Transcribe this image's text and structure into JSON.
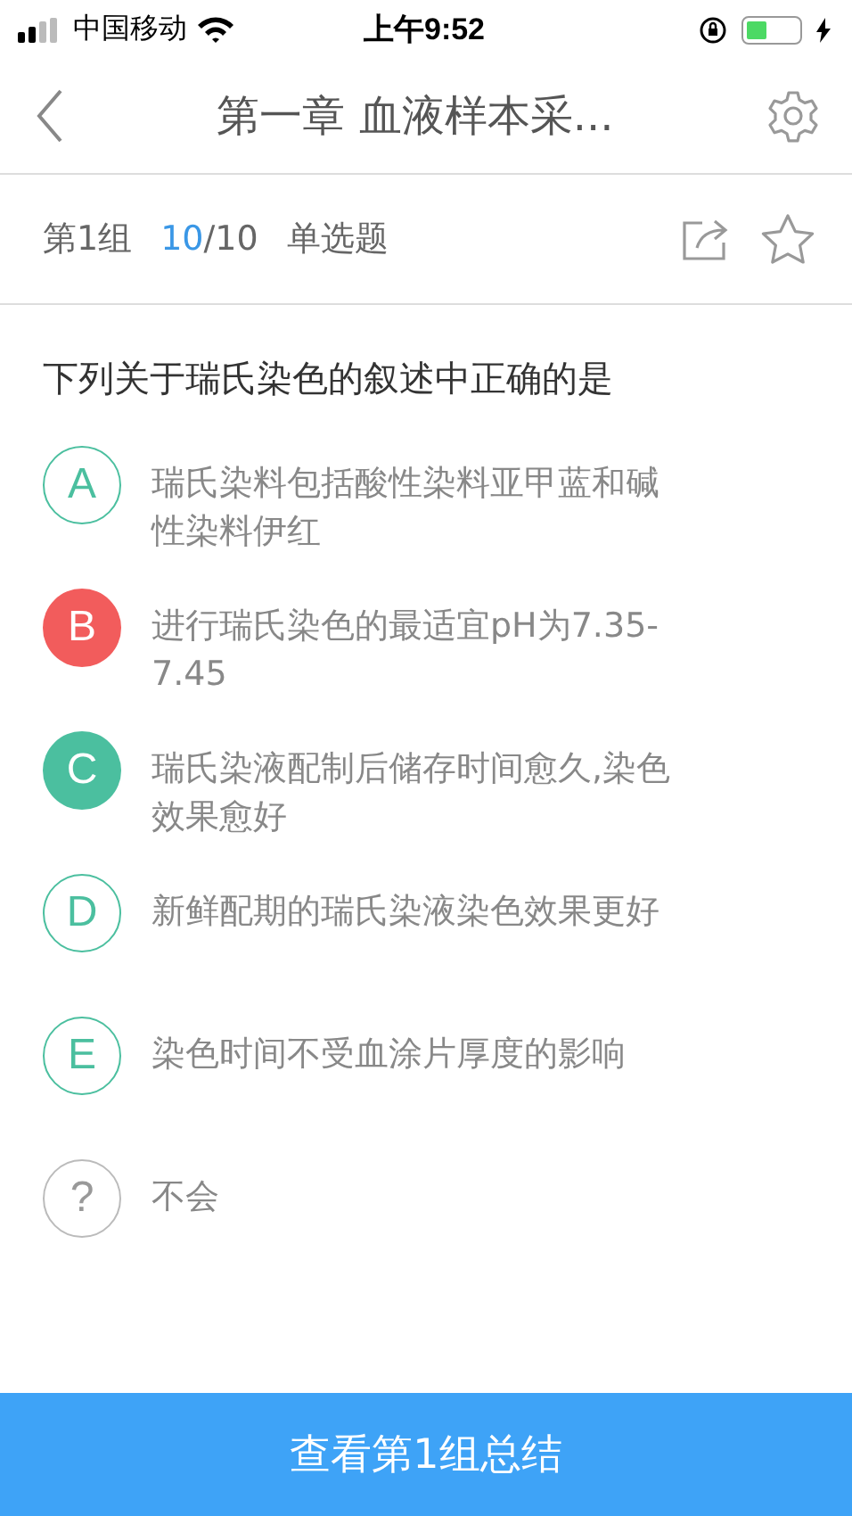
{
  "status_bar": {
    "carrier": "中国移动",
    "time": "上午9:52"
  },
  "nav": {
    "title": "第一章  血液样本采..."
  },
  "info": {
    "group": "第1组",
    "current": "10",
    "total": "/10",
    "type": "单选题"
  },
  "question": "下列关于瑞氏染色的叙述中正确的是",
  "options": [
    {
      "letter": "A",
      "text": "瑞氏染料包括酸性染料亚甲蓝和碱性染料伊红",
      "kind": "plain"
    },
    {
      "letter": "B",
      "text": "进行瑞氏染色的最适宜pH为7.35-7.45",
      "kind": "wrong"
    },
    {
      "letter": "C",
      "text": "瑞氏染液配制后储存时间愈久,染色效果愈好",
      "kind": "correct"
    },
    {
      "letter": "D",
      "text": "新鲜配期的瑞氏染液染色效果更好",
      "kind": "plain"
    },
    {
      "letter": "E",
      "text": "染色时间不受血涂片厚度的影响",
      "kind": "plain"
    },
    {
      "letter": "?",
      "text": "不会",
      "kind": "unknown"
    }
  ],
  "summary_button": "查看第1组总结"
}
